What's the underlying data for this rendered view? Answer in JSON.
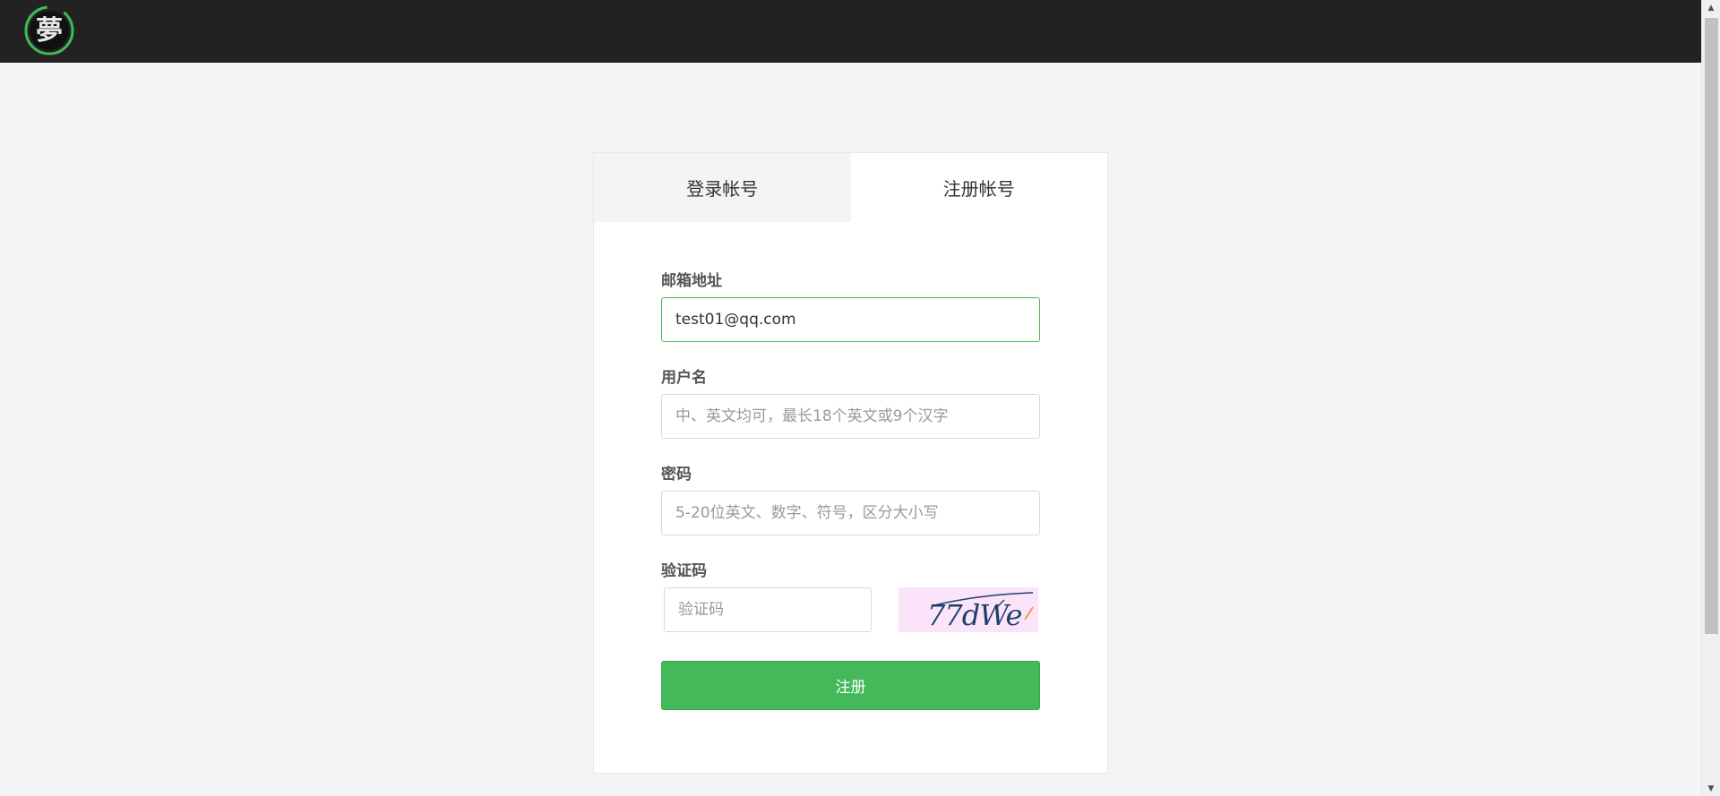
{
  "header": {
    "logo_icon": "logo-icon"
  },
  "tabs": [
    {
      "label": "登录帐号",
      "active": false
    },
    {
      "label": "注册帐号",
      "active": true
    }
  ],
  "form": {
    "email": {
      "label": "邮箱地址",
      "value": "test01@qq.com",
      "placeholder": ""
    },
    "username": {
      "label": "用户名",
      "value": "",
      "placeholder": "中、英文均可，最长18个英文或9个汉字"
    },
    "password": {
      "label": "密码",
      "value": "",
      "placeholder": "5-20位英文、数字、符号，区分大小写"
    },
    "captcha": {
      "label": "验证码",
      "value": "",
      "placeholder": "验证码",
      "image_text": "77dWe"
    },
    "submit_label": "注册"
  },
  "colors": {
    "accent": "#43b95a",
    "topbar": "#222222",
    "page_bg": "#f4f4f4"
  }
}
